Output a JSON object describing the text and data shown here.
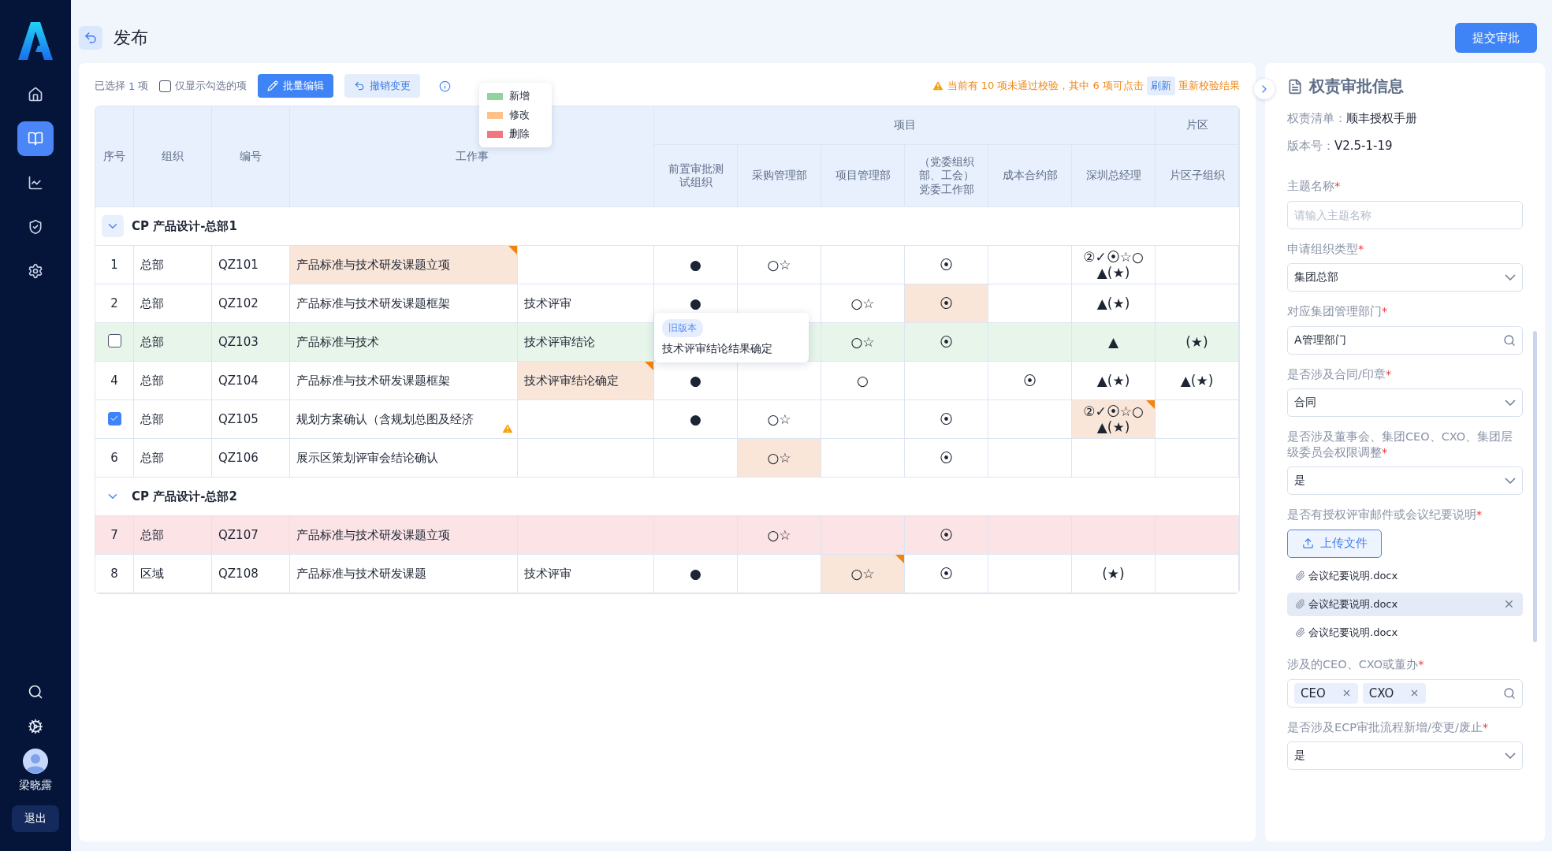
{
  "sidebar": {
    "nav": [
      {
        "selected": false
      },
      {
        "selected": true
      },
      {
        "selected": false
      },
      {
        "selected": false
      },
      {
        "selected": false
      }
    ],
    "user": "梁晓露",
    "logout": "退出"
  },
  "header": {
    "title": "发布",
    "submit": "提交审批"
  },
  "toolbar": {
    "selected_prefix": "已选择",
    "selected_count": "1",
    "selected_suffix": "项",
    "only_checked": {
      "label": "仅显示勾选的项",
      "checked": false
    },
    "batch_edit": "批量编辑",
    "undo": "撤销变更",
    "warning": "当前有 10 项未通过校验，其中 6 项可点击",
    "refresh": "刷新",
    "warning_tail": "重新校验结果"
  },
  "legend": [
    {
      "label": "新增",
      "color": "#8fd49e"
    },
    {
      "label": "修改",
      "color": "#fdc18a"
    },
    {
      "label": "删除",
      "color": "#f07680"
    }
  ],
  "table": {
    "fixed_columns": [
      "序号",
      "组织",
      "编号",
      "工作事"
    ],
    "groups": [
      {
        "label": "项目",
        "columns": [
          "前置审批测试组织",
          "采购管理部",
          "项目管理部",
          "（党委组织部、工会）党委工作部",
          "成本合约部",
          "深圳总经理"
        ]
      },
      {
        "label": "片区",
        "columns": [
          "片区子组织"
        ]
      }
    ],
    "rows": [
      {
        "kind": "group",
        "label": "CP 产品设计-总部1",
        "expanded": true,
        "highlighted": true
      },
      {
        "kind": "data",
        "added": false,
        "deleted": false,
        "lead": {
          "kind": "number",
          "text": "1"
        },
        "cells": [
          "总部",
          "QZ101",
          {
            "text": "产品标准与技术研发课题立项",
            "modified": true,
            "corner_mark": true
          },
          null,
          "●",
          "○☆",
          null,
          "⦿",
          null,
          "②✓⦿☆○\n▲(★)",
          null
        ]
      },
      {
        "kind": "data",
        "added": false,
        "deleted": false,
        "lead": {
          "kind": "number",
          "text": "2"
        },
        "cells": [
          "总部",
          "QZ102",
          "产品标准与技术研发课题框架",
          "技术评审",
          "●",
          null,
          "○☆",
          {
            "text": "⦿",
            "modified": true,
            "corner_mark": false
          },
          null,
          "▲(★)",
          null
        ]
      },
      {
        "kind": "data",
        "added": true,
        "deleted": false,
        "lead": {
          "kind": "checkbox",
          "checked": false
        },
        "cells": [
          "总部",
          "QZ103",
          "产品标准与技术",
          "技术评审结论",
          null,
          null,
          "○☆",
          "⦿",
          null,
          "▲",
          "(★)"
        ]
      },
      {
        "kind": "data",
        "added": false,
        "deleted": false,
        "lead": {
          "kind": "number",
          "text": "4"
        },
        "cells": [
          "总部",
          "QZ104",
          "产品标准与技术研发课题框架",
          {
            "text": "技术评审结论确定",
            "modified": true,
            "corner_mark": true
          },
          "●",
          null,
          "○",
          null,
          "⦿",
          "▲(★)",
          "▲(★)"
        ]
      },
      {
        "kind": "data",
        "added": false,
        "deleted": false,
        "lead": {
          "kind": "checkbox",
          "checked": true
        },
        "cells": [
          "总部",
          "QZ105",
          {
            "text": "规划方案确认（含规划总图及经济",
            "warning": true
          },
          null,
          "●",
          "○☆",
          null,
          "⦿",
          null,
          {
            "text": "②✓⦿☆○\n▲(★)",
            "modified": true,
            "corner_mark": true
          },
          null
        ]
      },
      {
        "kind": "data",
        "added": false,
        "deleted": false,
        "lead": {
          "kind": "number",
          "text": "6"
        },
        "cells": [
          "总部",
          "QZ106",
          "展示区策划评审会结论确认",
          null,
          null,
          {
            "text": "○☆",
            "modified": true,
            "corner_mark": false
          },
          null,
          "⦿",
          null,
          null,
          null
        ]
      },
      {
        "kind": "group",
        "label": "CP 产品设计-总部2",
        "expanded": true,
        "highlighted": false
      },
      {
        "kind": "data",
        "added": false,
        "deleted": true,
        "lead": {
          "kind": "number",
          "text": "7"
        },
        "cells": [
          "总部",
          "QZ107",
          "产品标准与技术研发课题立项",
          null,
          null,
          "○☆",
          null,
          "⦿",
          null,
          null,
          null
        ]
      },
      {
        "kind": "data",
        "added": false,
        "deleted": false,
        "lead": {
          "kind": "number",
          "text": "8"
        },
        "cells": [
          "区域",
          "QZ108",
          "产品标准与技术研发课题",
          "技术评审",
          "●",
          null,
          {
            "text": "○☆",
            "modified": true,
            "corner_mark": true
          },
          "⦿",
          null,
          "(★)",
          null
        ]
      }
    ]
  },
  "tooltip": {
    "tag": "旧版本",
    "text": "技术评审结论结果确定"
  },
  "panel": {
    "title": "权责审批信息",
    "info": [
      {
        "label": "权责清单：",
        "value": "顺丰授权手册"
      },
      {
        "label": "版本号：",
        "value": "V2.5-1-19"
      }
    ],
    "fields": [
      {
        "kind": "input",
        "label": "主题名称",
        "required_mark": "*",
        "placeholder": "请输入主题名称"
      },
      {
        "kind": "select",
        "label": "申请组织类型",
        "required_mark": "*",
        "value": "集团总部"
      },
      {
        "kind": "search",
        "label": "对应集团管理部门",
        "required_mark": "*",
        "value": "A管理部门"
      },
      {
        "kind": "select",
        "label": "是否涉及合同/印章",
        "required_mark": "*",
        "value": "合同"
      },
      {
        "kind": "select",
        "label": "是否涉及董事会、集团CEO、CXO、集团层级委员会权限调整",
        "required_mark": "*",
        "value": "是"
      },
      {
        "kind": "upload",
        "label": "是否有授权评审邮件或会议纪要说明",
        "required_mark": "*",
        "button": "上传文件",
        "files": [
          {
            "name": "会议纪要说明.docx",
            "hovered": false
          },
          {
            "name": "会议纪要说明.docx",
            "hovered": true
          },
          {
            "name": "会议纪要说明.docx",
            "hovered": false
          }
        ]
      },
      {
        "kind": "tags",
        "label": "涉及的CEO、CXO或董办",
        "required_mark": "*",
        "tags": [
          "CEO",
          "CXO"
        ]
      },
      {
        "kind": "select",
        "label": "是否涉及ECP审批流程新增/变更/废止",
        "required_mark": "*",
        "value": "是"
      }
    ]
  }
}
